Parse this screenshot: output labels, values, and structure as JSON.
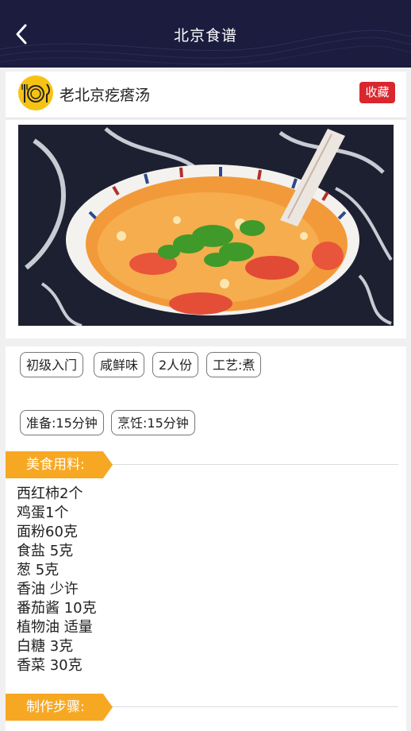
{
  "nav": {
    "title": "北京食谱"
  },
  "recipe": {
    "name": "老北京疙瘩汤",
    "favorite_label": "收藏"
  },
  "tags": [
    "初级入门",
    "咸鲜味",
    "2人份",
    "工艺:煮"
  ],
  "times": [
    "准备:15分钟",
    "烹饪:15分钟"
  ],
  "sections": {
    "ingredients_title": "美食用料:",
    "steps_title": "制作步骤:"
  },
  "ingredients": [
    "西红柿2个",
    "鸡蛋1个",
    "面粉60克",
    "食盐 5克",
    "葱 5克",
    "香油 少许",
    "番茄酱 10克",
    "植物油 适量",
    "白糖 3克",
    "香菜 30克"
  ],
  "colors": {
    "nav_bg": "#1b1c3e",
    "favorite_bg": "#d9272e",
    "section_label_bg": "#f7a823",
    "logo_bg": "#f6c315"
  },
  "icons": {
    "back": "chevron-left-icon",
    "logo": "plate-fork-knife-icon"
  }
}
